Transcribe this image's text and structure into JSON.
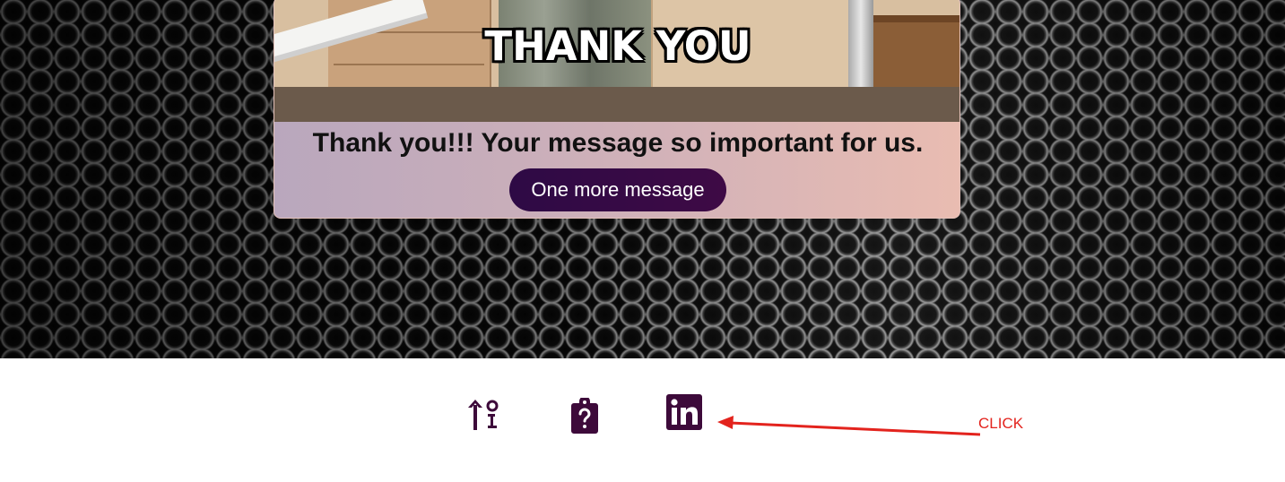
{
  "card": {
    "gif_caption": "THANK YOU",
    "message": "Thank you!!! Your message so important for us.",
    "button_label": "One more message"
  },
  "footer": {
    "icons": [
      {
        "name": "sort-info-icon"
      },
      {
        "name": "clipboard-question-icon"
      },
      {
        "name": "linkedin-icon"
      }
    ]
  },
  "annotation": {
    "label": "CLICK",
    "color": "#e3231d"
  },
  "colors": {
    "accent": "#3e0a45",
    "icon": "#3d0a3a",
    "card_gradient_start": "#b9a7bd",
    "card_gradient_end": "#e9bcb1"
  }
}
